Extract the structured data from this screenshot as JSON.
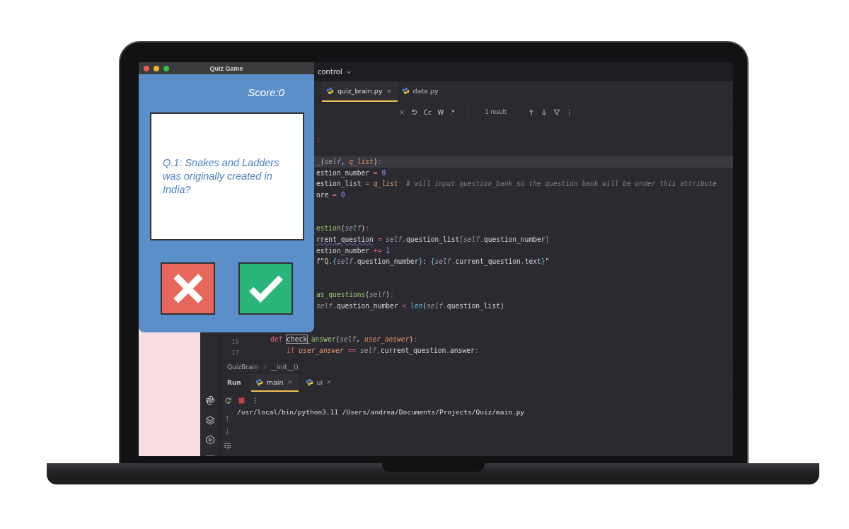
{
  "quiz_window": {
    "title": "Quiz Game",
    "score": "Score:0",
    "question": "Q.1: Snakes and Ladders was originally created in India?",
    "answer_buttons": [
      {
        "kind": "wrong"
      },
      {
        "kind": "right"
      }
    ]
  },
  "ide": {
    "title_bar": {
      "menu": "control"
    },
    "editor_tabs": [
      {
        "label": "quiz_brain.py",
        "selected": true,
        "closable": true
      },
      {
        "label": "data.py",
        "selected": false,
        "closable": false
      }
    ],
    "find_bar": {
      "options": [
        "Cc",
        "W",
        ".*"
      ],
      "result": "1 result"
    },
    "code_rows": [
      {
        "kind": "empty",
        "current": false
      },
      {
        "kind": "clipped",
        "current": false,
        "tokens": [
          {
            "text": ":",
            "kind": "keyword"
          }
        ]
      },
      {
        "kind": "empty",
        "current": false
      },
      {
        "kind": "clipped",
        "current": true,
        "tokens": [
          {
            "text": "_",
            "kind": "func"
          },
          {
            "text": "(",
            "kind": "plain"
          },
          {
            "text": "self",
            "kind": "self"
          },
          {
            "text": ", ",
            "kind": "plain"
          },
          {
            "text": "q_list",
            "kind": "param"
          },
          {
            "text": ")",
            "kind": "plain"
          },
          {
            "text": ":",
            "kind": "keyword"
          }
        ]
      },
      {
        "kind": "clipped",
        "current": false,
        "tokens": [
          {
            "text": "estion_number",
            "kind": "plain"
          },
          {
            "text": " = ",
            "kind": "op"
          },
          {
            "text": "0",
            "kind": "number"
          }
        ]
      },
      {
        "kind": "clipped",
        "current": false,
        "tokens": [
          {
            "text": "estion_list",
            "kind": "plain"
          },
          {
            "text": " = ",
            "kind": "op"
          },
          {
            "text": "q_list",
            "kind": "param"
          },
          {
            "text": "  # will input question_bank so the question bank will be under this attribute",
            "kind": "comment"
          }
        ]
      },
      {
        "kind": "clipped",
        "current": false,
        "tokens": [
          {
            "text": "ore",
            "kind": "plain"
          },
          {
            "text": " = ",
            "kind": "op"
          },
          {
            "text": "0",
            "kind": "number"
          }
        ]
      },
      {
        "kind": "empty",
        "current": false
      },
      {
        "kind": "empty",
        "current": false
      },
      {
        "kind": "clipped",
        "current": false,
        "tokens": [
          {
            "text": "estion",
            "kind": "func"
          },
          {
            "text": "(",
            "kind": "plain"
          },
          {
            "text": "self",
            "kind": "self"
          },
          {
            "text": ")",
            "kind": "plain"
          },
          {
            "text": ":",
            "kind": "keyword"
          }
        ]
      },
      {
        "kind": "clipped",
        "current": false,
        "tokens": [
          {
            "text": "rrent_question",
            "kind": "warn"
          },
          {
            "text": " = ",
            "kind": "op"
          },
          {
            "text": "self",
            "kind": "self"
          },
          {
            "text": ".",
            "kind": "dot"
          },
          {
            "text": "question_list",
            "kind": "plain"
          },
          {
            "text": "[",
            "kind": "dot"
          },
          {
            "text": "self",
            "kind": "self"
          },
          {
            "text": ".",
            "kind": "dot"
          },
          {
            "text": "question_number",
            "kind": "plain"
          },
          {
            "text": "]",
            "kind": "dot"
          }
        ]
      },
      {
        "kind": "clipped",
        "current": false,
        "tokens": [
          {
            "text": "estion_number",
            "kind": "plain"
          },
          {
            "text": " += ",
            "kind": "op"
          },
          {
            "text": "1",
            "kind": "number"
          }
        ]
      },
      {
        "kind": "clipped",
        "current": false,
        "tokens": [
          {
            "text": "f\"Q.",
            "kind": "string"
          },
          {
            "text": "{",
            "kind": "brace"
          },
          {
            "text": "self",
            "kind": "self"
          },
          {
            "text": ".",
            "kind": "dot"
          },
          {
            "text": "question_number",
            "kind": "plain"
          },
          {
            "text": "}",
            "kind": "brace"
          },
          {
            "text": ": ",
            "kind": "string"
          },
          {
            "text": "{",
            "kind": "brace"
          },
          {
            "text": "self",
            "kind": "self"
          },
          {
            "text": ".",
            "kind": "dot"
          },
          {
            "text": "current_question",
            "kind": "plain"
          },
          {
            "text": ".",
            "kind": "dot"
          },
          {
            "text": "text",
            "kind": "plain"
          },
          {
            "text": "}",
            "kind": "brace"
          },
          {
            "text": "\"",
            "kind": "string"
          }
        ]
      },
      {
        "kind": "empty",
        "current": false
      },
      {
        "kind": "empty",
        "current": false
      },
      {
        "kind": "clipped",
        "current": false,
        "tokens": [
          {
            "text": "as_questions",
            "kind": "func"
          },
          {
            "text": "(",
            "kind": "plain"
          },
          {
            "text": "self",
            "kind": "self"
          },
          {
            "text": ")",
            "kind": "plain"
          },
          {
            "text": ":",
            "kind": "keyword"
          }
        ]
      },
      {
        "kind": "clipped",
        "current": false,
        "tokens": [
          {
            "text": "self",
            "kind": "self"
          },
          {
            "text": ".",
            "kind": "dot"
          },
          {
            "text": "question_number",
            "kind": "plain"
          },
          {
            "text": " < ",
            "kind": "op"
          },
          {
            "text": "len",
            "kind": "builtin"
          },
          {
            "text": "(",
            "kind": "plain"
          },
          {
            "text": "self",
            "kind": "self"
          },
          {
            "text": ".",
            "kind": "dot"
          },
          {
            "text": "question_list",
            "kind": "plain"
          },
          {
            "text": ")",
            "kind": "plain"
          }
        ]
      },
      {
        "kind": "empty",
        "current": false
      },
      {
        "kind": "empty",
        "current": false
      },
      {
        "kind": "method",
        "current": false,
        "number": "16",
        "tokens": [
          {
            "text": "def ",
            "kind": "keyword"
          },
          {
            "text": "check",
            "kind": "match"
          },
          {
            "text": "_answer",
            "kind": "func"
          },
          {
            "text": "(",
            "kind": "plain"
          },
          {
            "text": "self",
            "kind": "self"
          },
          {
            "text": ", ",
            "kind": "plain"
          },
          {
            "text": "user_answer",
            "kind": "param"
          },
          {
            "text": ")",
            "kind": "plain"
          },
          {
            "text": ":",
            "kind": "keyword"
          }
        ]
      },
      {
        "kind": "body",
        "current": false,
        "number": "17",
        "tokens": [
          {
            "text": "if ",
            "kind": "keyword"
          },
          {
            "text": "user_answer",
            "kind": "param"
          },
          {
            "text": " == ",
            "kind": "op"
          },
          {
            "text": "self",
            "kind": "self"
          },
          {
            "text": ".",
            "kind": "dot"
          },
          {
            "text": "current_question",
            "kind": "plain"
          },
          {
            "text": ".",
            "kind": "dot"
          },
          {
            "text": "answer",
            "kind": "plain"
          },
          {
            "text": ":",
            "kind": "keyword"
          }
        ]
      }
    ],
    "breadcrumb": [
      "QuizBrain",
      "__init__()"
    ],
    "tool_window": {
      "title": "Run",
      "tabs": [
        {
          "label": "main",
          "selected": true,
          "closable": true
        },
        {
          "label": "ui",
          "selected": false,
          "closable": true
        }
      ],
      "console": [
        "/usr/local/bin/python3.11 /Users/andrea/Documents/Projects/Quiz/main.py"
      ]
    }
  }
}
